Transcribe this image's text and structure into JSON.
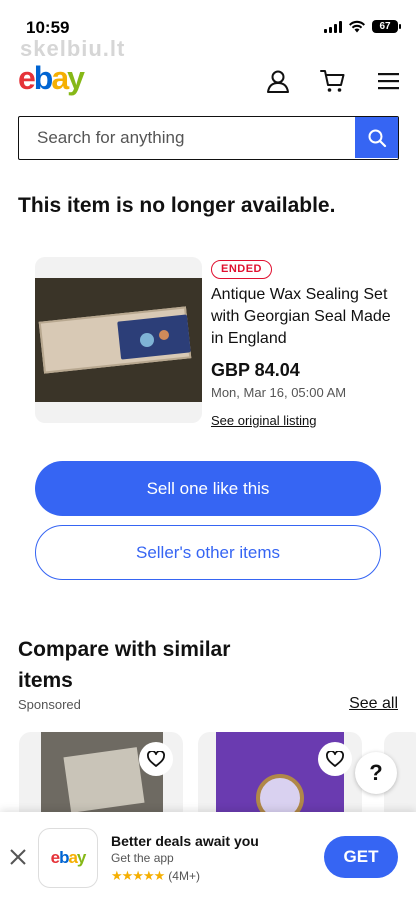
{
  "status_bar": {
    "time": "10:59",
    "battery": "67"
  },
  "watermark": "skelbiu.lt",
  "header": {
    "logo": {
      "e": "e",
      "b": "b",
      "a": "a",
      "y": "y"
    },
    "icons": [
      "user-icon",
      "cart-icon",
      "menu-icon"
    ]
  },
  "search": {
    "placeholder": "Search for anything"
  },
  "page": {
    "heading": "This item is no longer available."
  },
  "item": {
    "badge": "ENDED",
    "title": "Antique Wax Sealing Set with Georgian Seal Made in England",
    "price": "GBP 84.04",
    "date": "Mon, Mar 16, 05:00 AM",
    "original_link": "See original listing"
  },
  "actions": {
    "sell_label": "Sell one like this",
    "seller_items_label": "Seller's other items"
  },
  "compare": {
    "title": "Compare with similar items",
    "sponsored": "Sponsored",
    "see_all": "See all"
  },
  "help": {
    "label": "?"
  },
  "app_banner": {
    "app_icon_text": "ebay",
    "title": "Better deals await you",
    "subtitle": "Get the app",
    "stars": "★★★★★",
    "rating_count": "(4M+)",
    "get_label": "GET"
  },
  "colors": {
    "accent_blue": "#3665f3",
    "ended_red": "#e0102f",
    "logo_red": "#e53238",
    "logo_blue": "#0064d2",
    "logo_yellow": "#f5af02",
    "logo_green": "#86b817"
  }
}
